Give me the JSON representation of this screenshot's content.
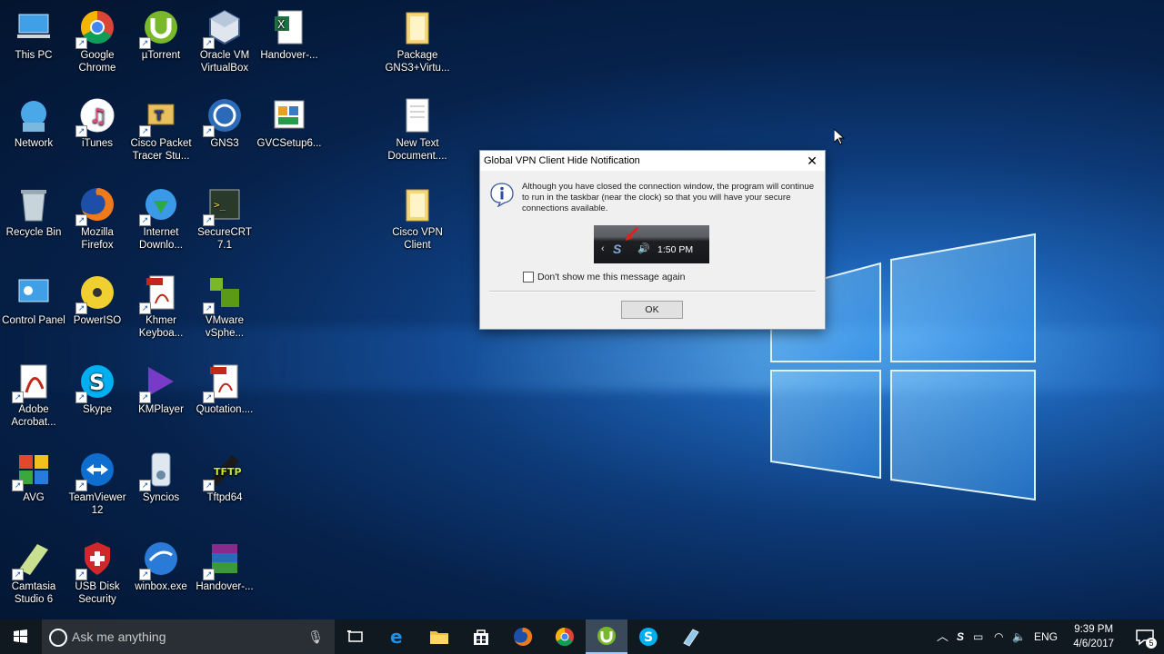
{
  "desktop": {
    "icons": [
      {
        "label": "This PC",
        "icon": "this-pc-icon"
      },
      {
        "label": "Google Chrome",
        "icon": "chrome-icon"
      },
      {
        "label": "µTorrent",
        "icon": "utorrent-icon"
      },
      {
        "label": "Oracle VM VirtualBox",
        "icon": "virtualbox-icon"
      },
      {
        "label": "Handover-...",
        "icon": "excel-file-icon"
      },
      {
        "label": "Package GNS3+Virtu...",
        "icon": "folder-icon"
      },
      {
        "label": "Network",
        "icon": "network-icon"
      },
      {
        "label": "iTunes",
        "icon": "itunes-icon"
      },
      {
        "label": "Cisco Packet Tracer Stu...",
        "icon": "packet-tracer-icon"
      },
      {
        "label": "GNS3",
        "icon": "gns3-icon"
      },
      {
        "label": "GVCSetup6...",
        "icon": "installer-icon"
      },
      {
        "label": "New Text Document....",
        "icon": "text-file-icon"
      },
      {
        "label": "Recycle Bin",
        "icon": "recycle-bin-icon"
      },
      {
        "label": "Mozilla Firefox",
        "icon": "firefox-icon"
      },
      {
        "label": "Internet Downlo...",
        "icon": "idm-icon"
      },
      {
        "label": "SecureCRT 7.1",
        "icon": "securecrt-icon"
      },
      {
        "label": "Cisco VPN Client",
        "icon": "folder-icon"
      },
      {
        "label": "Control Panel",
        "icon": "control-panel-icon"
      },
      {
        "label": "PowerISO",
        "icon": "poweriso-icon"
      },
      {
        "label": "Khmer Keyboa...",
        "icon": "pdf-icon"
      },
      {
        "label": "VMware vSphe...",
        "icon": "vmware-icon"
      },
      {
        "label": "Adobe Acrobat...",
        "icon": "acrobat-icon"
      },
      {
        "label": "Skype",
        "icon": "skype-icon"
      },
      {
        "label": "KMPlayer",
        "icon": "kmplayer-icon"
      },
      {
        "label": "Quotation....",
        "icon": "pdf-icon"
      },
      {
        "label": "AVG",
        "icon": "avg-icon"
      },
      {
        "label": "TeamViewer 12",
        "icon": "teamviewer-icon"
      },
      {
        "label": "Syncios",
        "icon": "syncios-icon"
      },
      {
        "label": "Tftpd64",
        "icon": "tftpd-icon"
      },
      {
        "label": "Camtasia Studio 6",
        "icon": "camtasia-icon"
      },
      {
        "label": "USB Disk Security",
        "icon": "usb-security-icon"
      },
      {
        "label": "winbox.exe",
        "icon": "winbox-icon"
      },
      {
        "label": "Handover-...",
        "icon": "winrar-icon"
      }
    ]
  },
  "dialog": {
    "title": "Global VPN Client Hide Notification",
    "message": "Although you have closed the connection window, the program will continue to run in the taskbar (near the clock) so that you will have your secure connections available.",
    "preview_time": "1:50 PM",
    "checkbox_label": "Don't show me this message again",
    "ok_label": "OK"
  },
  "taskbar": {
    "search_placeholder": "Ask me anything",
    "apps": [
      "task-view-icon",
      "edge-icon",
      "file-explorer-icon",
      "store-icon",
      "firefox-icon",
      "chrome-icon",
      "utorrent-icon",
      "skype-icon",
      "notepad-icon"
    ],
    "language": "ENG",
    "time": "9:39 PM",
    "date": "4/6/2017",
    "notification_count": "5"
  }
}
